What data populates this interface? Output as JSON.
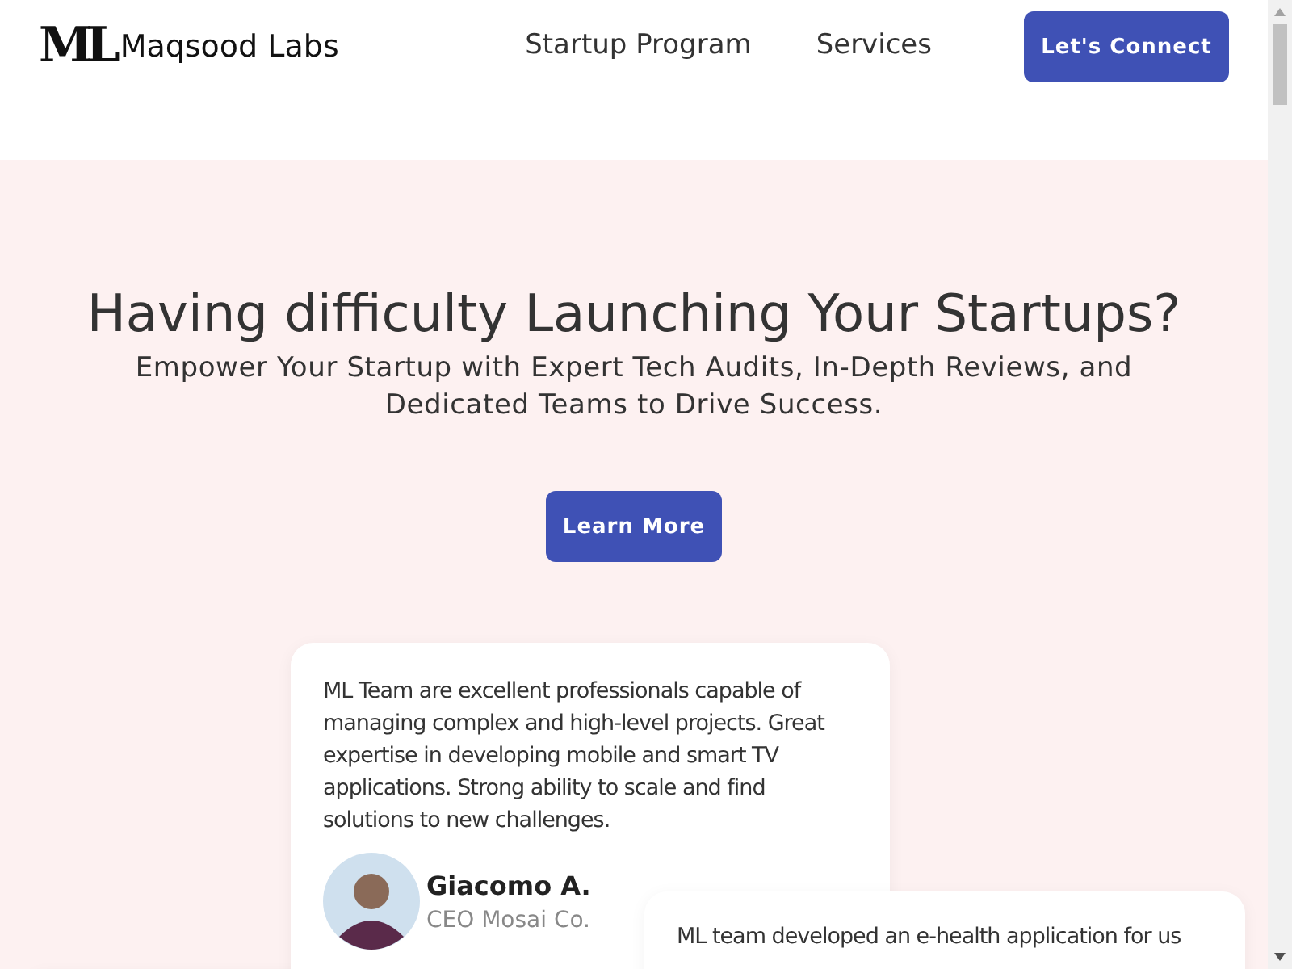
{
  "header": {
    "logo_mark": "ML",
    "brand": "Maqsood Labs",
    "nav": [
      {
        "label": "Startup Program"
      },
      {
        "label": "Services"
      }
    ],
    "cta": "Let's Connect"
  },
  "hero": {
    "title": "Having difficulty Launching Your Startups?",
    "subtitle": "Empower Your Startup with Expert Tech Audits, In-Depth Reviews, and Dedicated Teams to Drive Success.",
    "button": "Learn More"
  },
  "testimonials": [
    {
      "quote": "ML Team are excellent professionals capable of managing complex and high-level projects. Great expertise in developing mobile and smart TV applications. Strong ability to scale and find solutions to new challenges.",
      "name": "Giacomo A.",
      "role": "CEO Mosai Co."
    },
    {
      "quote": "ML team developed an e-health application for us"
    }
  ]
}
